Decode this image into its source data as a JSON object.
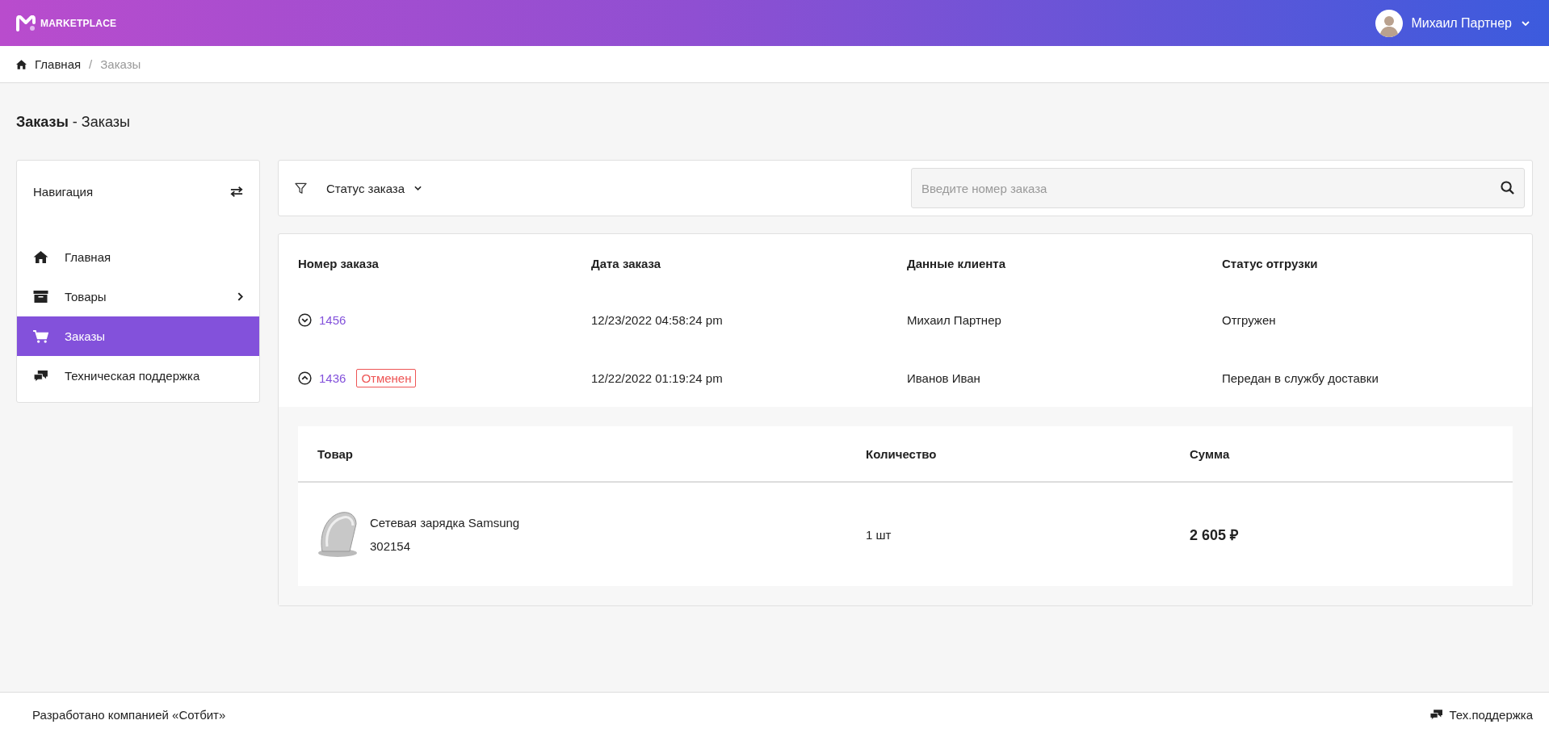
{
  "header": {
    "logo_text": "MARKETPLACE",
    "user_name": "Михаил Партнер"
  },
  "breadcrumb": {
    "separator": "/",
    "items": [
      {
        "label": "Главная",
        "current": false
      },
      {
        "label": "Заказы",
        "current": true
      }
    ]
  },
  "page_title": "**Заказы** - Заказы",
  "sidebar": {
    "title": "Навигация",
    "items": [
      {
        "label": "Главная",
        "kind": "home",
        "selected": false,
        "has_submenu": false
      },
      {
        "label": "Товары",
        "kind": "catalog",
        "selected": false,
        "has_submenu": true
      },
      {
        "label": "Заказы",
        "kind": "orders",
        "selected": true,
        "has_submenu": false
      },
      {
        "label": "Техническая поддержка",
        "kind": "support",
        "selected": false,
        "has_submenu": false
      }
    ]
  },
  "filter": {
    "label": "Статус заказа",
    "search_placeholder": "Введите номер заказа"
  },
  "orders": {
    "columns": [
      "Номер заказа",
      "Дата заказа",
      "Данные клиента",
      "Статус отгрузки"
    ],
    "rows": [
      {
        "number": "1456",
        "date": "12/23/2022 04:58:24 pm",
        "client": "Михаил Партнер",
        "shipment": "Отгружен",
        "expanded": false
      },
      {
        "number": "1436",
        "badge": "Отменен",
        "date": "12/22/2022 01:19:24 pm",
        "client": "Иванов Иван",
        "shipment": "Передан в службу доставки",
        "expanded": true,
        "detail_columns": [
          "Товар",
          "Количество",
          "Сумма"
        ],
        "items": [
          {
            "name": "Сетевая зарядка Samsung",
            "sku": "302154",
            "quantity": "1 шт",
            "sum": "2 605 ₽"
          }
        ]
      }
    ]
  },
  "footer": {
    "credit": "Разработано компанией «Сотбит»",
    "support": "Тех.поддержка"
  }
}
